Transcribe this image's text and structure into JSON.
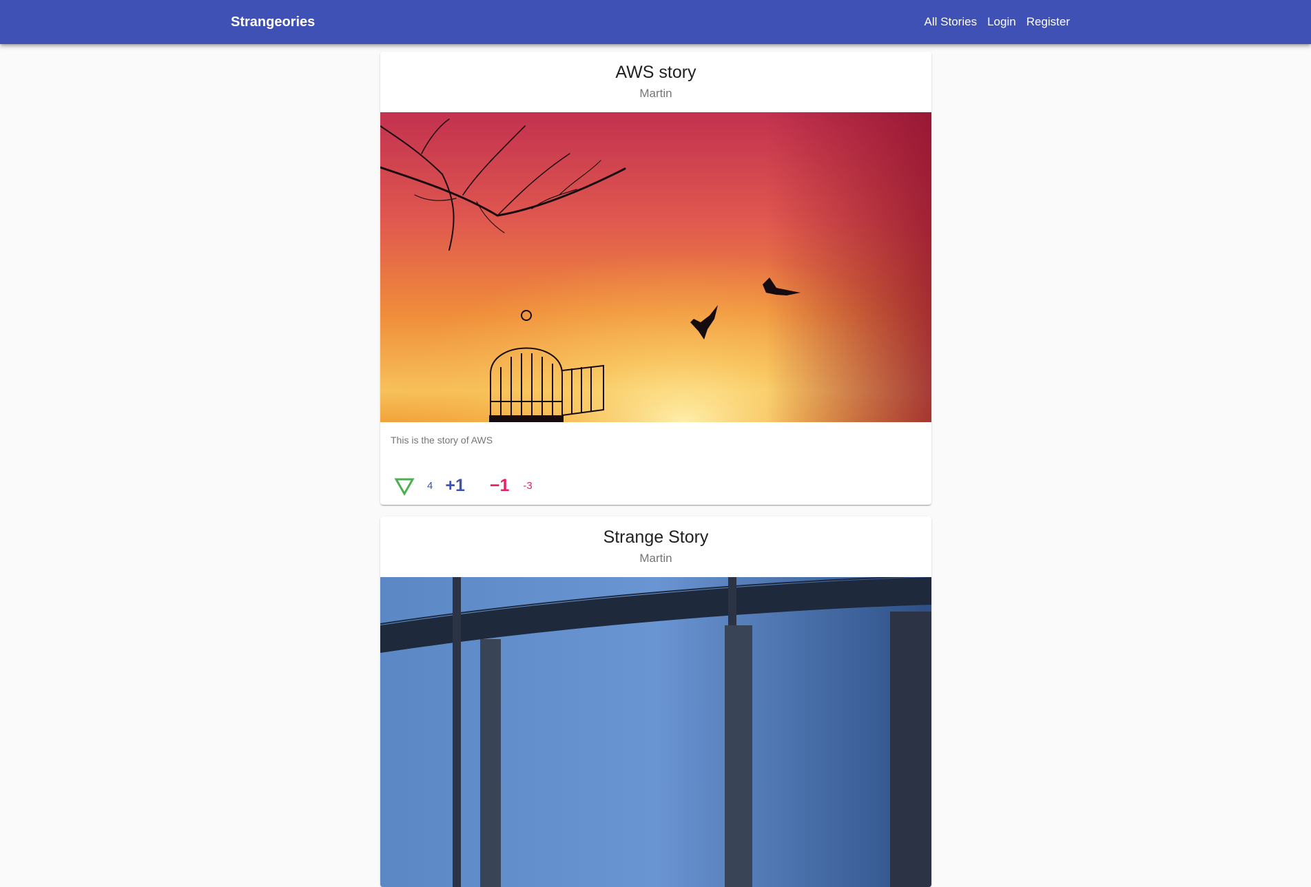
{
  "toolbar": {
    "brand": "Strangeories",
    "nav": [
      "All Stories",
      "Login",
      "Register"
    ]
  },
  "stories": [
    {
      "title": "AWS story",
      "author": "Martin",
      "description": "This is the story of AWS",
      "score": "4",
      "upvote_label": "+1",
      "downvote_label": "−1",
      "down_count": "-3",
      "vote_icon": "triangle-down-outline-icon"
    },
    {
      "title": "Strange Story",
      "author": "Martin"
    }
  ],
  "colors": {
    "primary": "#3f51b5",
    "accent": "#e91e63",
    "vote_icon": "#4caf50",
    "background": "#fafafa"
  }
}
